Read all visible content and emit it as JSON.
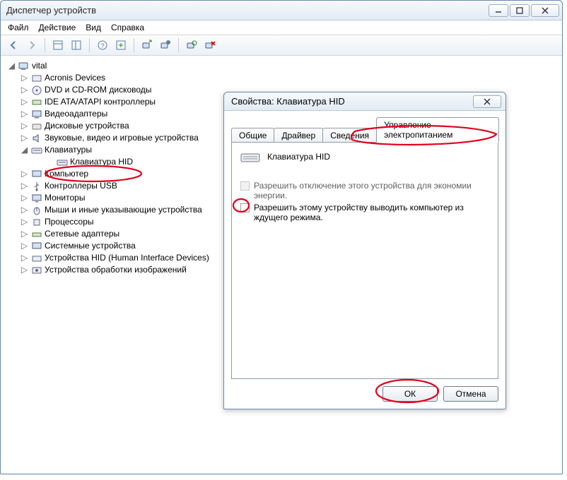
{
  "window": {
    "title": "Диспетчер устройств",
    "menu": {
      "file": "Файл",
      "action": "Действие",
      "view": "Вид",
      "help": "Справка"
    }
  },
  "tree": {
    "root": "vital",
    "items": {
      "acronis": "Acronis Devices",
      "dvd": "DVD и CD-ROM дисководы",
      "ide": "IDE ATA/ATAPI контроллеры",
      "video": "Видеоадаптеры",
      "disk": "Дисковые устройства",
      "sound": "Звуковые, видео и игровые устройства",
      "keyboards": "Клавиатуры",
      "hidkb": "Клавиатура HID",
      "computer": "Компьютер",
      "usb": "Контроллеры USB",
      "monitors": "Мониторы",
      "mice": "Мыши и иные указывающие устройства",
      "cpu": "Процессоры",
      "net": "Сетевые адаптеры",
      "system": "Системные устройства",
      "hid": "Устройства HID (Human Interface Devices)",
      "imaging": "Устройства обработки изображений"
    }
  },
  "dialog": {
    "title": "Свойства: Клавиатура HID",
    "tabs": {
      "general": "Общие",
      "driver": "Драйвер",
      "details": "Сведения",
      "power": "Управление электропитанием"
    },
    "device_name": "Клавиатура HID",
    "chk_allow_off": "Разрешить отключение этого устройства для экономии энергии.",
    "chk_allow_wake": "Разрешить этому устройству выводить компьютер из ждущего режима.",
    "ok": "ОК",
    "cancel": "Отмена"
  }
}
